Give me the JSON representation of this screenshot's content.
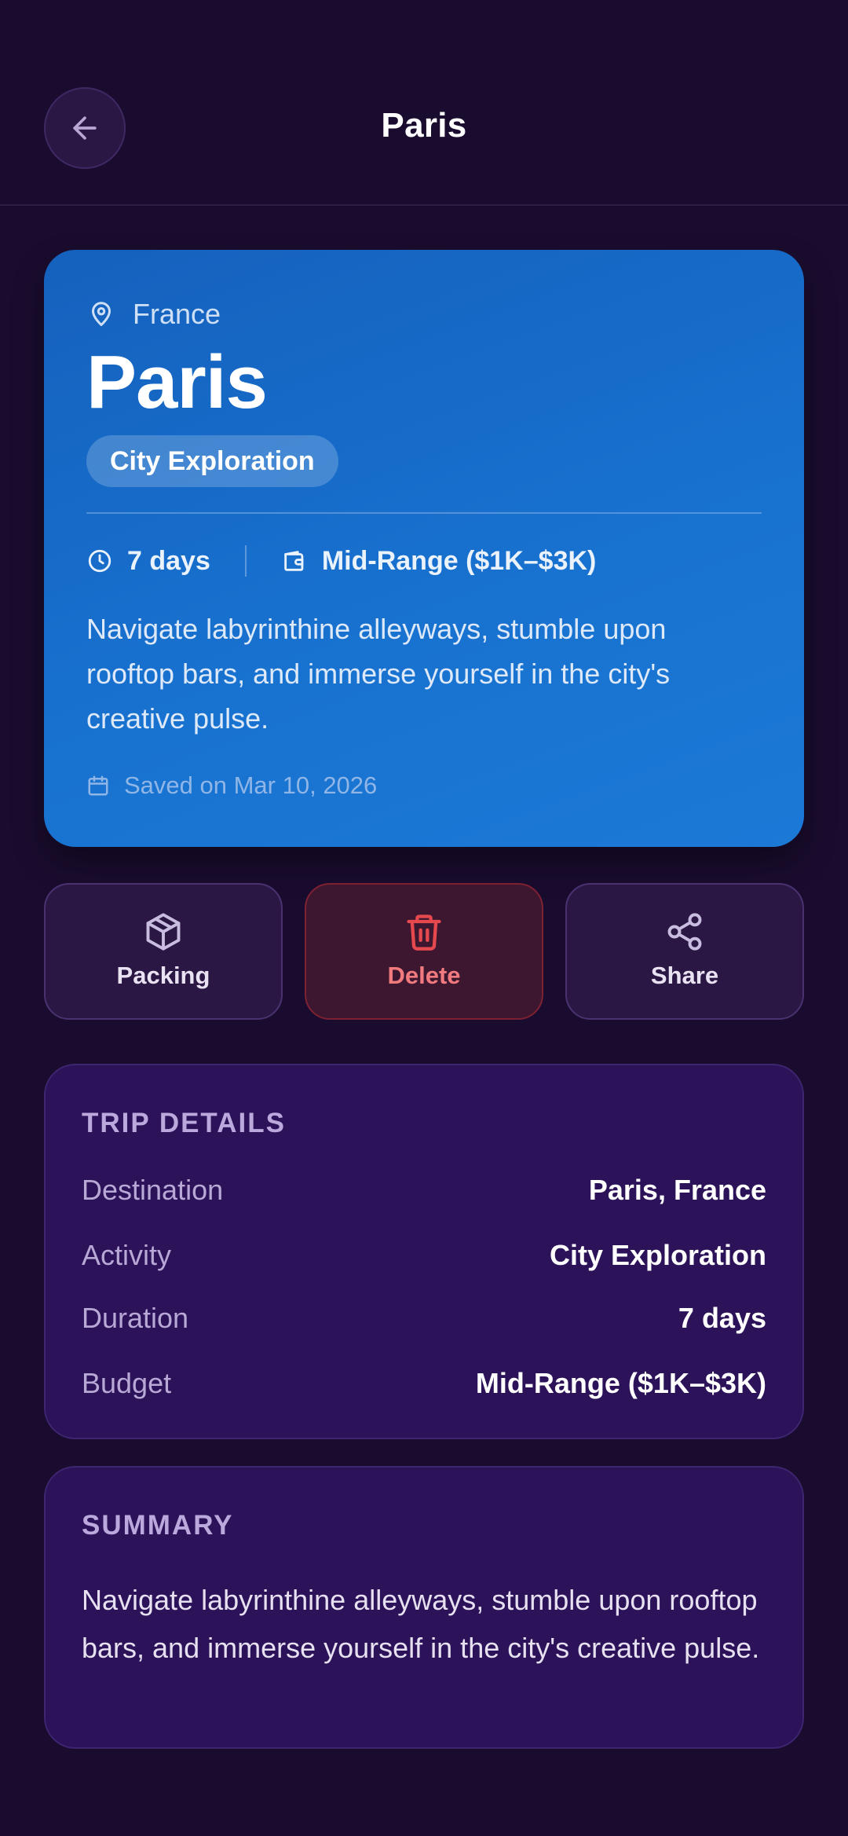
{
  "header": {
    "title": "Paris"
  },
  "hero": {
    "country": "France",
    "city": "Paris",
    "activity_badge": "City Exploration",
    "duration": "7 days",
    "budget": "Mid-Range ($1K–$3K)",
    "description": "Navigate labyrinthine alleyways, stumble upon rooftop bars, and immerse yourself in the city's creative pulse.",
    "saved_on": "Saved on Mar 10, 2026"
  },
  "actions": {
    "packing": "Packing",
    "delete": "Delete",
    "share": "Share"
  },
  "details": {
    "title": "TRIP DETAILS",
    "rows": [
      {
        "label": "Destination",
        "value": "Paris, France"
      },
      {
        "label": "Activity",
        "value": "City Exploration"
      },
      {
        "label": "Duration",
        "value": "7 days"
      },
      {
        "label": "Budget",
        "value": "Mid-Range ($1K–$3K)"
      }
    ]
  },
  "summary": {
    "title": "SUMMARY",
    "text": "Navigate labyrinthine alleyways, stumble upon rooftop bars, and immerse yourself in the city's creative pulse."
  },
  "icons": {
    "back": "arrow-left-icon",
    "location": "map-pin-icon",
    "duration": "clock-icon",
    "budget": "wallet-icon",
    "saved": "calendar-icon",
    "packing": "package-icon",
    "delete": "trash-icon",
    "share": "share-icon"
  },
  "colors": {
    "background": "#1a0c2e",
    "hero_gradient_start": "#1561bd",
    "hero_gradient_end": "#1c79d6",
    "card": "#2c1259",
    "delete_accent": "#e5484d"
  }
}
